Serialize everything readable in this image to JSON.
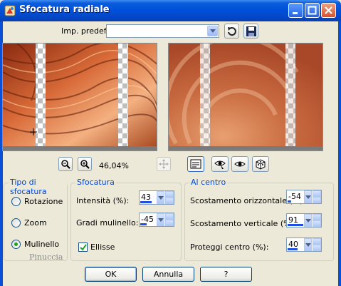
{
  "window": {
    "title": "Sfocatura radiale",
    "icon": "paint-shop-pro-icon"
  },
  "title_buttons": [
    "minimize-icon",
    "maximize-icon",
    "close-icon"
  ],
  "preset": {
    "label": "Imp. predef.:",
    "value": "",
    "reset_icon": "reset-icon",
    "save_icon": "save-icon"
  },
  "zoom": {
    "value": "46,04%",
    "zoom_out_icon": "zoom-out-icon",
    "zoom_in_icon": "zoom-in-icon",
    "pan_icon": "move-icon"
  },
  "preview_tools": [
    "proof-icon",
    "eye-pointer-icon",
    "eye-icon",
    "randomize-icon"
  ],
  "groups": {
    "type": {
      "title": "Tipo di sfocatura",
      "options": [
        {
          "label": "Rotazione",
          "selected": false
        },
        {
          "label": "Zoom",
          "selected": false
        },
        {
          "label": "Mulinello",
          "selected": true
        }
      ]
    },
    "blur": {
      "title": "Sfocatura",
      "intensity_label": "Intensità (%):",
      "intensity_value": "43",
      "twirl_label": "Gradi mulinello:",
      "twirl_value": "-45",
      "ellipse_label": "Ellisse",
      "ellipse_checked": true
    },
    "center": {
      "title": "Al centro",
      "h_offset_label": "Scostamento orizzontale (%):",
      "h_offset_value": "-54",
      "v_offset_label": "Scostamento verticale (%):",
      "v_offset_value": "91",
      "protect_label": "Proteggi centro (%):",
      "protect_value": "40"
    }
  },
  "buttons": {
    "ok": "OK",
    "cancel": "Annulla",
    "help": "?"
  },
  "watermark": "Pinuccia",
  "colors": {
    "titlebar": "#0050D8",
    "face": "#ECE9D8",
    "legend": "#0046D5",
    "accent_bar": "#2050E0"
  }
}
